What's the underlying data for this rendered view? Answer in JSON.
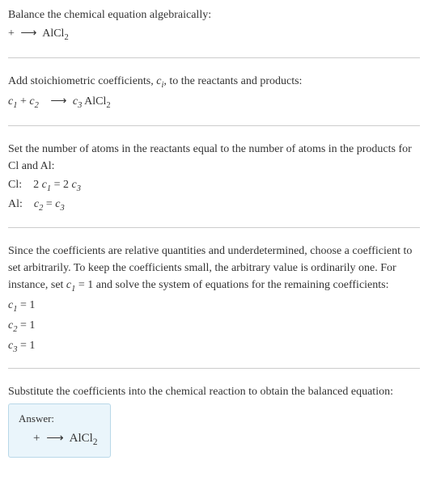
{
  "section1": {
    "heading": "Balance the chemical equation algebraically:",
    "reaction_lhs": " + ",
    "reaction_arrow": "⟶",
    "reaction_rhs_compound": "AlCl",
    "reaction_rhs_sub": "2"
  },
  "section2": {
    "heading_part1": "Add stoichiometric coefficients, ",
    "heading_ci": "c",
    "heading_ci_sub": "i",
    "heading_part2": ", to the reactants and products:",
    "c1": "c",
    "c1_sub": "1",
    "plus": " + ",
    "c2": "c",
    "c2_sub": "2",
    "arrow": "⟶",
    "c3": "c",
    "c3_sub": "3",
    "compound": " AlCl",
    "compound_sub": "2"
  },
  "section3": {
    "heading": "Set the number of atoms in the reactants equal to the number of atoms in the products for Cl and Al:",
    "cl_label": "Cl:",
    "cl_eq_2": "2 ",
    "cl_eq_c1": "c",
    "cl_eq_c1_sub": "1",
    "cl_eq_eq": " = 2 ",
    "cl_eq_c3": "c",
    "cl_eq_c3_sub": "3",
    "al_label": "Al:",
    "al_eq_c2": "c",
    "al_eq_c2_sub": "2",
    "al_eq_eq": " = ",
    "al_eq_c3": "c",
    "al_eq_c3_sub": "3"
  },
  "section4": {
    "heading_part1": "Since the coefficients are relative quantities and underdetermined, choose a coefficient to set arbitrarily. To keep the coefficients small, the arbitrary value is ordinarily one. For instance, set ",
    "heading_c1": "c",
    "heading_c1_sub": "1",
    "heading_part2": " = 1 and solve the system of equations for the remaining coefficients:",
    "c1": "c",
    "c1_sub": "1",
    "c1_val": " = 1",
    "c2": "c",
    "c2_sub": "2",
    "c2_val": " = 1",
    "c3": "c",
    "c3_sub": "3",
    "c3_val": " = 1"
  },
  "section5": {
    "heading": "Substitute the coefficients into the chemical reaction to obtain the balanced equation:",
    "answer_label": "Answer:",
    "answer_lhs": " + ",
    "answer_arrow": "⟶",
    "answer_compound": " AlCl",
    "answer_sub": "2"
  }
}
